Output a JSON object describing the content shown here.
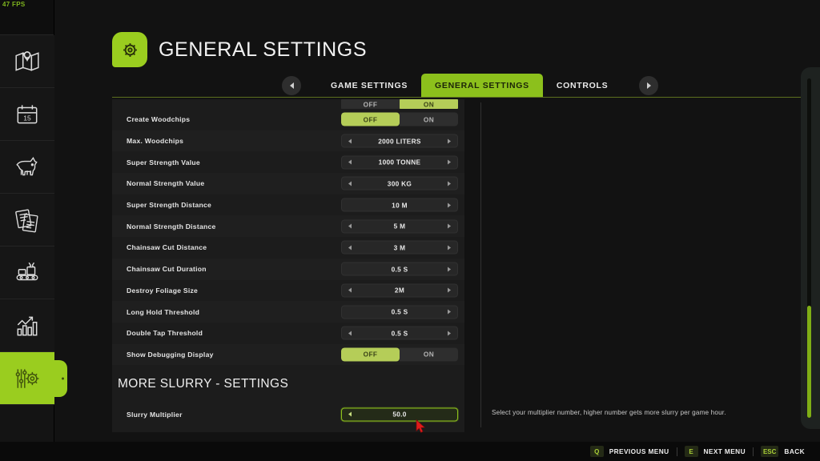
{
  "hud": {
    "fps": "47 FPS"
  },
  "header": {
    "title": "GENERAL SETTINGS",
    "icon": "gear-icon"
  },
  "tabs": {
    "prev_arrow": "chevron-left-icon",
    "next_arrow": "chevron-right-icon",
    "items": [
      {
        "label": "GAME SETTINGS",
        "active": false
      },
      {
        "label": "GENERAL SETTINGS",
        "active": true
      },
      {
        "label": "CONTROLS",
        "active": false
      }
    ]
  },
  "sidebar": {
    "items": [
      {
        "name": "map-icon",
        "active": false
      },
      {
        "name": "calendar-icon",
        "active": false,
        "day": "15"
      },
      {
        "name": "animals-icon",
        "active": false
      },
      {
        "name": "contracts-icon",
        "active": false
      },
      {
        "name": "production-icon",
        "active": false
      },
      {
        "name": "statistics-icon",
        "active": false
      },
      {
        "name": "settings-icon",
        "active": true
      }
    ]
  },
  "settings": {
    "clipped_row": {
      "label": "",
      "type": "toggle",
      "options": [
        "OFF",
        "ON"
      ],
      "selected": "ON"
    },
    "rows": [
      {
        "label": "Create Woodchips",
        "type": "toggle",
        "options": [
          "OFF",
          "ON"
        ],
        "selected": "OFF"
      },
      {
        "label": "Max. Woodchips",
        "type": "stepper",
        "value": "2000 LITERS",
        "left_arrow": true,
        "right_arrow": true
      },
      {
        "label": "Super Strength Value",
        "type": "stepper",
        "value": "1000 TONNE",
        "left_arrow": true,
        "right_arrow": true
      },
      {
        "label": "Normal Strength Value",
        "type": "stepper",
        "value": "300 KG",
        "left_arrow": true,
        "right_arrow": true
      },
      {
        "label": "Super Strength Distance",
        "type": "stepper",
        "value": "10 M",
        "left_arrow": false,
        "right_arrow": true
      },
      {
        "label": "Normal Strength Distance",
        "type": "stepper",
        "value": "5 M",
        "left_arrow": true,
        "right_arrow": true
      },
      {
        "label": "Chainsaw Cut Distance",
        "type": "stepper",
        "value": "3 M",
        "left_arrow": true,
        "right_arrow": true
      },
      {
        "label": "Chainsaw Cut Duration",
        "type": "stepper",
        "value": "0.5 S",
        "left_arrow": false,
        "right_arrow": true
      },
      {
        "label": "Destroy Foliage Size",
        "type": "stepper",
        "value": "2M",
        "left_arrow": true,
        "right_arrow": true
      },
      {
        "label": "Long Hold Threshold",
        "type": "stepper",
        "value": "0.5 S",
        "left_arrow": false,
        "right_arrow": true
      },
      {
        "label": "Double Tap Threshold",
        "type": "stepper",
        "value": "0.5 S",
        "left_arrow": true,
        "right_arrow": true
      },
      {
        "label": "Show Debugging Display",
        "type": "toggle",
        "options": [
          "OFF",
          "ON"
        ],
        "selected": "OFF"
      }
    ],
    "section_title": "MORE SLURRY - SETTINGS",
    "section_rows": [
      {
        "label": "Slurry Multiplier",
        "type": "stepper",
        "value": "50.0",
        "left_arrow": true,
        "right_arrow": false,
        "selected": true
      }
    ]
  },
  "help": {
    "text": "Select your multiplier number, higher number gets more slurry per game hour."
  },
  "bottom_bar": {
    "hints": [
      {
        "key": "Q",
        "label": "PREVIOUS MENU"
      },
      {
        "key": "E",
        "label": "NEXT MENU"
      },
      {
        "key": "ESC",
        "label": "BACK"
      }
    ]
  },
  "colors": {
    "accent": "#9acd1f",
    "accent_soft": "#b5cd58",
    "panel": "#1c1c1c",
    "panel_alt": "#1f1f1f"
  }
}
